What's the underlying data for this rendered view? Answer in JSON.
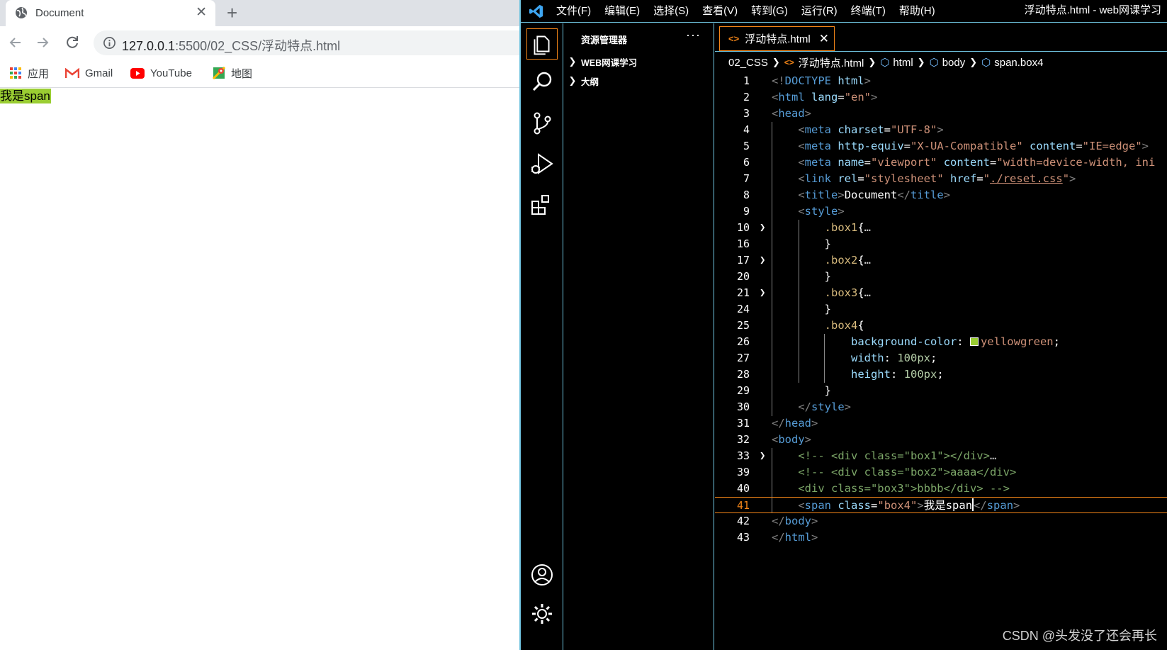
{
  "browser": {
    "tab_title": "Document",
    "url_host": "127.0.0.1",
    "url_rest": ":5500/02_CSS/浮动特点.html",
    "bookmarks": [
      "应用",
      "Gmail",
      "YouTube",
      "地图"
    ],
    "page_content": "我是span",
    "span_background": "#9acd32"
  },
  "vscode": {
    "menu": [
      "文件(F)",
      "编辑(E)",
      "选择(S)",
      "查看(V)",
      "转到(G)",
      "运行(R)",
      "终端(T)",
      "帮助(H)"
    ],
    "window_title": "浮动特点.html - web网课学习",
    "sidebar_title": "资源管理器",
    "sidebar_more": "···",
    "sections": [
      "WEB网课学习",
      "大纲"
    ],
    "editor_tab": "浮动特点.html",
    "breadcrumbs": [
      "02_CSS",
      "浮动特点.html",
      "html",
      "body",
      "span.box4"
    ],
    "line_numbers": [
      "1",
      "2",
      "3",
      "4",
      "5",
      "6",
      "7",
      "8",
      "9",
      "10",
      "16",
      "17",
      "20",
      "21",
      "24",
      "25",
      "26",
      "27",
      "28",
      "29",
      "30",
      "31",
      "32",
      "33",
      "39",
      "40",
      "41",
      "42",
      "43"
    ],
    "current_line": "41",
    "accent_color": "#f38518",
    "border_color": "#6fc3df"
  },
  "watermark": "CSDN @头发没了还会再长"
}
